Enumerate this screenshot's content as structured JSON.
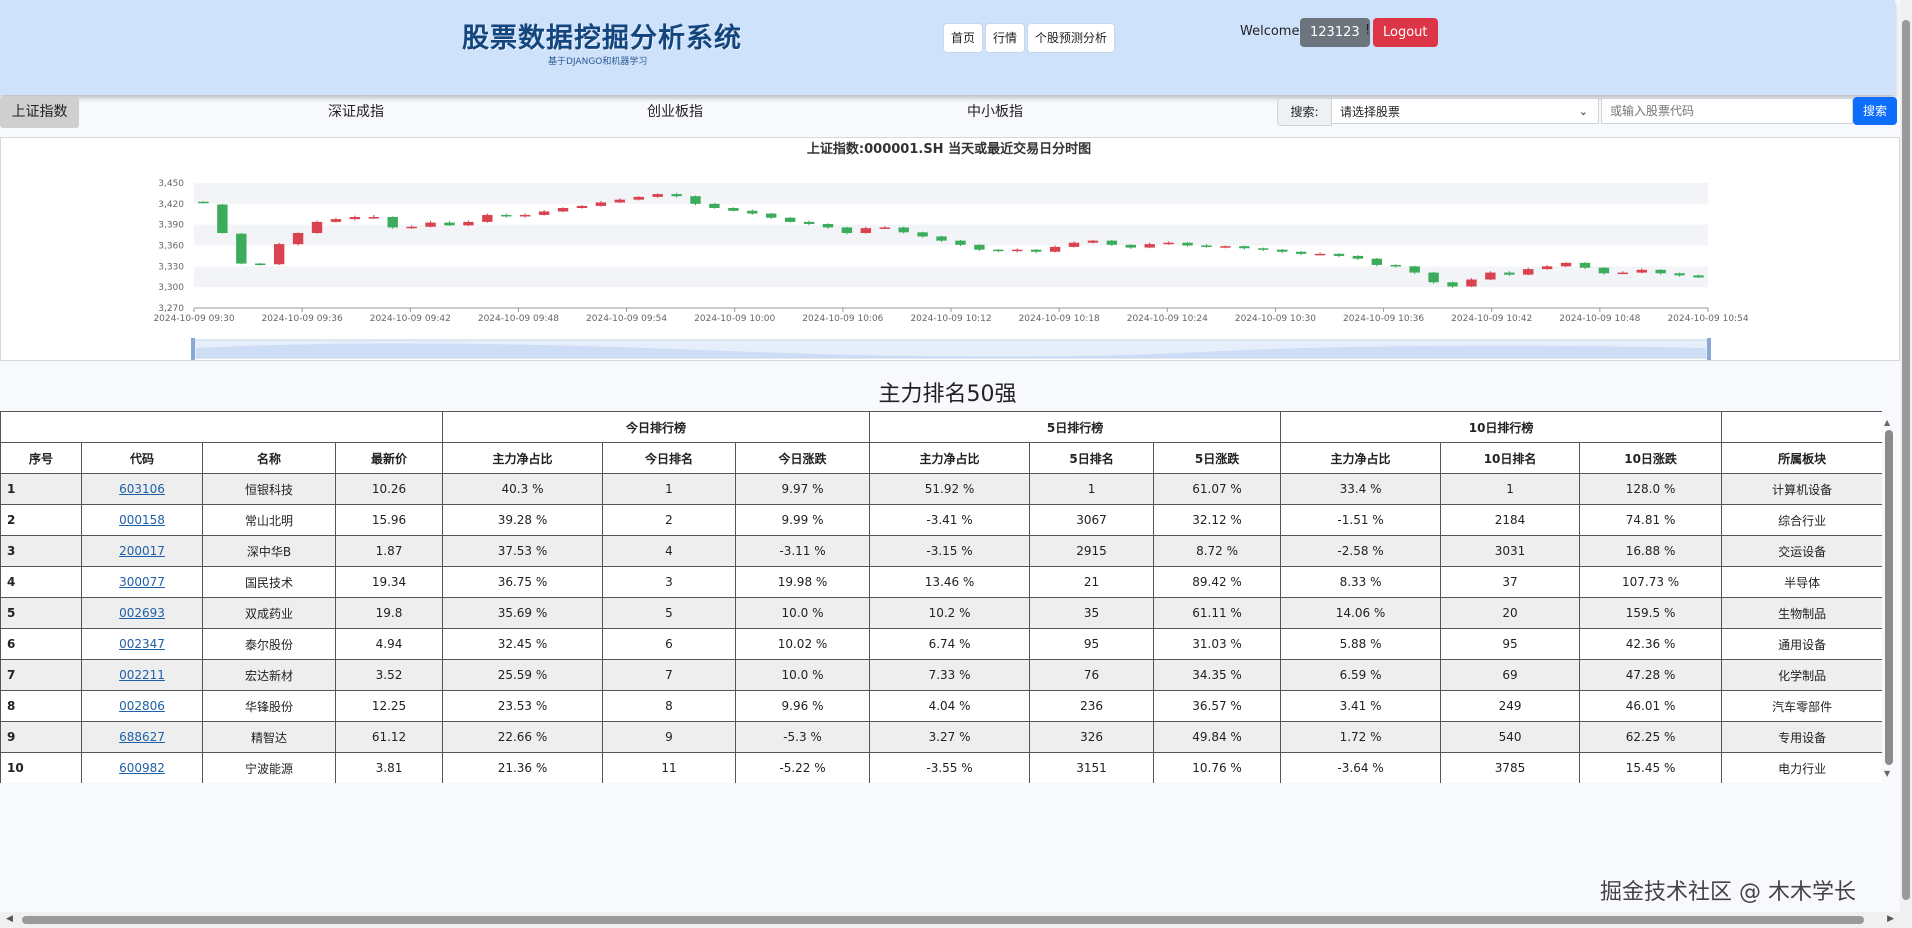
{
  "header": {
    "brand_title": "股票数据挖掘分析系统",
    "brand_subtitle": "基于DJANGO和机器学习",
    "nav": [
      "首页",
      "行情",
      "个股预测分析"
    ],
    "welcome": "Welcome,",
    "username": "123123",
    "exclaim": "!",
    "logout": "Logout"
  },
  "index_tabs": [
    "上证指数",
    "深证成指",
    "创业板指",
    "中小板指"
  ],
  "search": {
    "label": "搜索:",
    "select_value": "请选择股票",
    "code_placeholder": "或输入股票代码",
    "button": "搜索"
  },
  "colors": {
    "up": "#d9434f",
    "down": "#3cab5c",
    "header_bg": "#cfe2fb",
    "primary": "#0d6efd",
    "danger": "#dc3545"
  },
  "chart_data": {
    "type": "candlestick",
    "title": "上证指数:000001.SH    当天或最近交易日分时图",
    "ylim": [
      3270,
      3450
    ],
    "yticks": [
      "3,450",
      "3,420",
      "3,390",
      "3,360",
      "3,330",
      "3,300",
      "3,270"
    ],
    "xticks": [
      "2024-10-09 09:30",
      "2024-10-09 09:36",
      "2024-10-09 09:42",
      "2024-10-09 09:48",
      "2024-10-09 09:54",
      "2024-10-09 10:00",
      "2024-10-09 10:06",
      "2024-10-09 10:12",
      "2024-10-09 10:18",
      "2024-10-09 10:24",
      "2024-10-09 10:30",
      "2024-10-09 10:36",
      "2024-10-09 10:42",
      "2024-10-09 10:48",
      "2024-10-09 10:54"
    ],
    "ohlc": [
      [
        3423,
        3424,
        3421,
        3422
      ],
      [
        3419,
        3420,
        3377,
        3378
      ],
      [
        3377,
        3378,
        3333,
        3334
      ],
      [
        3334,
        3335,
        3331,
        3333
      ],
      [
        3333,
        3364,
        3332,
        3362
      ],
      [
        3362,
        3379,
        3360,
        3378
      ],
      [
        3378,
        3396,
        3377,
        3394
      ],
      [
        3394,
        3400,
        3393,
        3398
      ],
      [
        3398,
        3403,
        3396,
        3401
      ],
      [
        3401,
        3404,
        3398,
        3401
      ],
      [
        3401,
        3402,
        3384,
        3386
      ],
      [
        3386,
        3389,
        3384,
        3387
      ],
      [
        3387,
        3396,
        3386,
        3393
      ],
      [
        3393,
        3395,
        3388,
        3389
      ],
      [
        3389,
        3396,
        3388,
        3394
      ],
      [
        3394,
        3406,
        3393,
        3404
      ],
      [
        3404,
        3406,
        3400,
        3402
      ],
      [
        3402,
        3406,
        3400,
        3404
      ],
      [
        3404,
        3411,
        3403,
        3409
      ],
      [
        3409,
        3415,
        3408,
        3414
      ],
      [
        3414,
        3418,
        3413,
        3417
      ],
      [
        3417,
        3424,
        3416,
        3422
      ],
      [
        3422,
        3428,
        3421,
        3426
      ],
      [
        3426,
        3431,
        3425,
        3430
      ],
      [
        3430,
        3435,
        3429,
        3434
      ],
      [
        3434,
        3436,
        3429,
        3431
      ],
      [
        3431,
        3432,
        3418,
        3420
      ],
      [
        3420,
        3421,
        3413,
        3414
      ],
      [
        3414,
        3415,
        3409,
        3410
      ],
      [
        3410,
        3412,
        3404,
        3406
      ],
      [
        3406,
        3407,
        3398,
        3400
      ],
      [
        3400,
        3401,
        3393,
        3394
      ],
      [
        3394,
        3396,
        3389,
        3391
      ],
      [
        3391,
        3392,
        3384,
        3386
      ],
      [
        3386,
        3387,
        3376,
        3378
      ],
      [
        3378,
        3387,
        3377,
        3385
      ],
      [
        3385,
        3388,
        3384,
        3386
      ],
      [
        3386,
        3387,
        3377,
        3379
      ],
      [
        3379,
        3380,
        3371,
        3373
      ],
      [
        3373,
        3374,
        3365,
        3367
      ],
      [
        3367,
        3368,
        3359,
        3361
      ],
      [
        3361,
        3362,
        3352,
        3354
      ],
      [
        3354,
        3355,
        3350,
        3352
      ],
      [
        3352,
        3356,
        3350,
        3354
      ],
      [
        3354,
        3355,
        3349,
        3351
      ],
      [
        3351,
        3360,
        3350,
        3358
      ],
      [
        3358,
        3366,
        3357,
        3364
      ],
      [
        3364,
        3368,
        3363,
        3367
      ],
      [
        3367,
        3368,
        3359,
        3361
      ],
      [
        3361,
        3362,
        3355,
        3357
      ],
      [
        3357,
        3364,
        3356,
        3362
      ],
      [
        3362,
        3366,
        3361,
        3364
      ],
      [
        3364,
        3365,
        3358,
        3360
      ],
      [
        3360,
        3362,
        3357,
        3358
      ],
      [
        3358,
        3360,
        3356,
        3359
      ],
      [
        3359,
        3360,
        3354,
        3356
      ],
      [
        3356,
        3357,
        3352,
        3354
      ],
      [
        3354,
        3355,
        3349,
        3351
      ],
      [
        3351,
        3352,
        3346,
        3348
      ],
      [
        3348,
        3350,
        3346,
        3348
      ],
      [
        3348,
        3349,
        3343,
        3345
      ],
      [
        3345,
        3346,
        3339,
        3341
      ],
      [
        3341,
        3342,
        3330,
        3332
      ],
      [
        3332,
        3333,
        3328,
        3330
      ],
      [
        3330,
        3331,
        3319,
        3321
      ],
      [
        3321,
        3322,
        3305,
        3307
      ],
      [
        3307,
        3308,
        3299,
        3301
      ],
      [
        3301,
        3313,
        3300,
        3311
      ],
      [
        3311,
        3323,
        3310,
        3321
      ],
      [
        3321,
        3323,
        3316,
        3318
      ],
      [
        3318,
        3328,
        3317,
        3326
      ],
      [
        3326,
        3332,
        3325,
        3330
      ],
      [
        3330,
        3336,
        3329,
        3335
      ],
      [
        3335,
        3336,
        3326,
        3328
      ],
      [
        3328,
        3329,
        3318,
        3320
      ],
      [
        3320,
        3323,
        3319,
        3321
      ],
      [
        3321,
        3327,
        3320,
        3325
      ],
      [
        3325,
        3326,
        3318,
        3320
      ],
      [
        3320,
        3321,
        3315,
        3317
      ],
      [
        3317,
        3318,
        3313,
        3314
      ]
    ]
  },
  "ranking": {
    "title": "主力排名50强",
    "group_headers": [
      "今日排行榜",
      "5日排行榜",
      "10日排行榜"
    ],
    "columns": [
      "序号",
      "代码",
      "名称",
      "最新价",
      "主力净占比",
      "今日排名",
      "今日涨跌",
      "主力净占比",
      "5日排名",
      "5日涨跌",
      "主力净占比",
      "10日排名",
      "10日涨跌",
      "所属板块"
    ],
    "rows": [
      [
        "1",
        "603106",
        "恒银科技",
        "10.26",
        "40.3 %",
        "1",
        "9.97 %",
        "51.92 %",
        "1",
        "61.07 %",
        "33.4 %",
        "1",
        "128.0 %",
        "计算机设备"
      ],
      [
        "2",
        "000158",
        "常山北明",
        "15.96",
        "39.28 %",
        "2",
        "9.99 %",
        "-3.41 %",
        "3067",
        "32.12 %",
        "-1.51 %",
        "2184",
        "74.81 %",
        "综合行业"
      ],
      [
        "3",
        "200017",
        "深中华B",
        "1.87",
        "37.53 %",
        "4",
        "-3.11 %",
        "-3.15 %",
        "2915",
        "8.72 %",
        "-2.58 %",
        "3031",
        "16.88 %",
        "交运设备"
      ],
      [
        "4",
        "300077",
        "国民技术",
        "19.34",
        "36.75 %",
        "3",
        "19.98 %",
        "13.46 %",
        "21",
        "89.42 %",
        "8.33 %",
        "37",
        "107.73 %",
        "半导体"
      ],
      [
        "5",
        "002693",
        "双成药业",
        "19.8",
        "35.69 %",
        "5",
        "10.0 %",
        "10.2 %",
        "35",
        "61.11 %",
        "14.06 %",
        "20",
        "159.5 %",
        "生物制品"
      ],
      [
        "6",
        "002347",
        "泰尔股份",
        "4.94",
        "32.45 %",
        "6",
        "10.02 %",
        "6.74 %",
        "95",
        "31.03 %",
        "5.88 %",
        "95",
        "42.36 %",
        "通用设备"
      ],
      [
        "7",
        "002211",
        "宏达新材",
        "3.52",
        "25.59 %",
        "7",
        "10.0 %",
        "7.33 %",
        "76",
        "34.35 %",
        "6.59 %",
        "69",
        "47.28 %",
        "化学制品"
      ],
      [
        "8",
        "002806",
        "华锋股份",
        "12.25",
        "23.53 %",
        "8",
        "9.96 %",
        "4.04 %",
        "236",
        "36.57 %",
        "3.41 %",
        "249",
        "46.01 %",
        "汽车零部件"
      ],
      [
        "9",
        "688627",
        "精智达",
        "61.12",
        "22.66 %",
        "9",
        "-5.3 %",
        "3.27 %",
        "326",
        "49.84 %",
        "1.72 %",
        "540",
        "62.25 %",
        "专用设备"
      ],
      [
        "10",
        "600982",
        "宁波能源",
        "3.81",
        "21.36 %",
        "11",
        "-5.22 %",
        "-3.55 %",
        "3151",
        "10.76 %",
        "-3.64 %",
        "3785",
        "15.45 %",
        "电力行业"
      ]
    ]
  },
  "footer_mark": "掘金技术社区 @ 木木学长"
}
